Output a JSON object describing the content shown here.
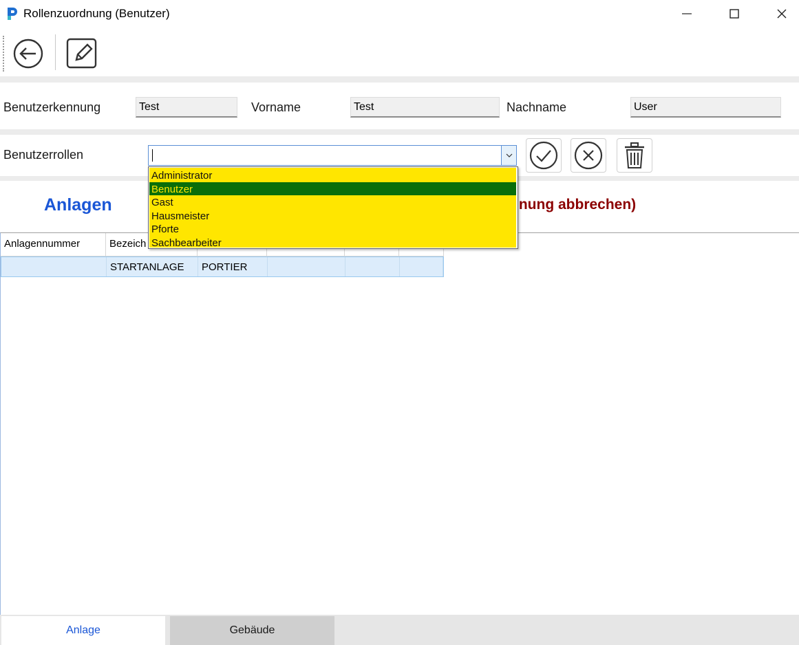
{
  "window": {
    "title": "Rollenzuordnung (Benutzer)"
  },
  "toolbar": {
    "back_icon": "back-arrow-icon",
    "edit_icon": "edit-pencil-icon"
  },
  "user": {
    "id_label": "Benutzerkennung",
    "id_value": "Test",
    "firstname_label": "Vorname",
    "firstname_value": "Test",
    "lastname_label": "Nachname",
    "lastname_value": "User"
  },
  "roles": {
    "label": "Benutzerrollen",
    "combo_value": "",
    "options": [
      "Administrator",
      "Benutzer",
      "Gast",
      "Hausmeister",
      "Pforte",
      "Sachbearbeiter"
    ],
    "selected": "Benutzer",
    "highlight_color": "#ffe600",
    "selected_color": "#0a6e0a"
  },
  "section": {
    "heading": "Anlagen",
    "cancel_fragment": "lnung abbrechen)"
  },
  "table": {
    "columns": [
      "Anlagennummer",
      "Bezeich",
      "",
      "",
      "",
      ""
    ],
    "rows": [
      [
        "",
        "STARTANLAGE",
        "PORTIER",
        "",
        "",
        ""
      ]
    ]
  },
  "tabs": [
    "Anlage",
    "Gebäude"
  ],
  "colors": {
    "heading_blue": "#1a56d6",
    "cancel_red": "#8b0000"
  }
}
